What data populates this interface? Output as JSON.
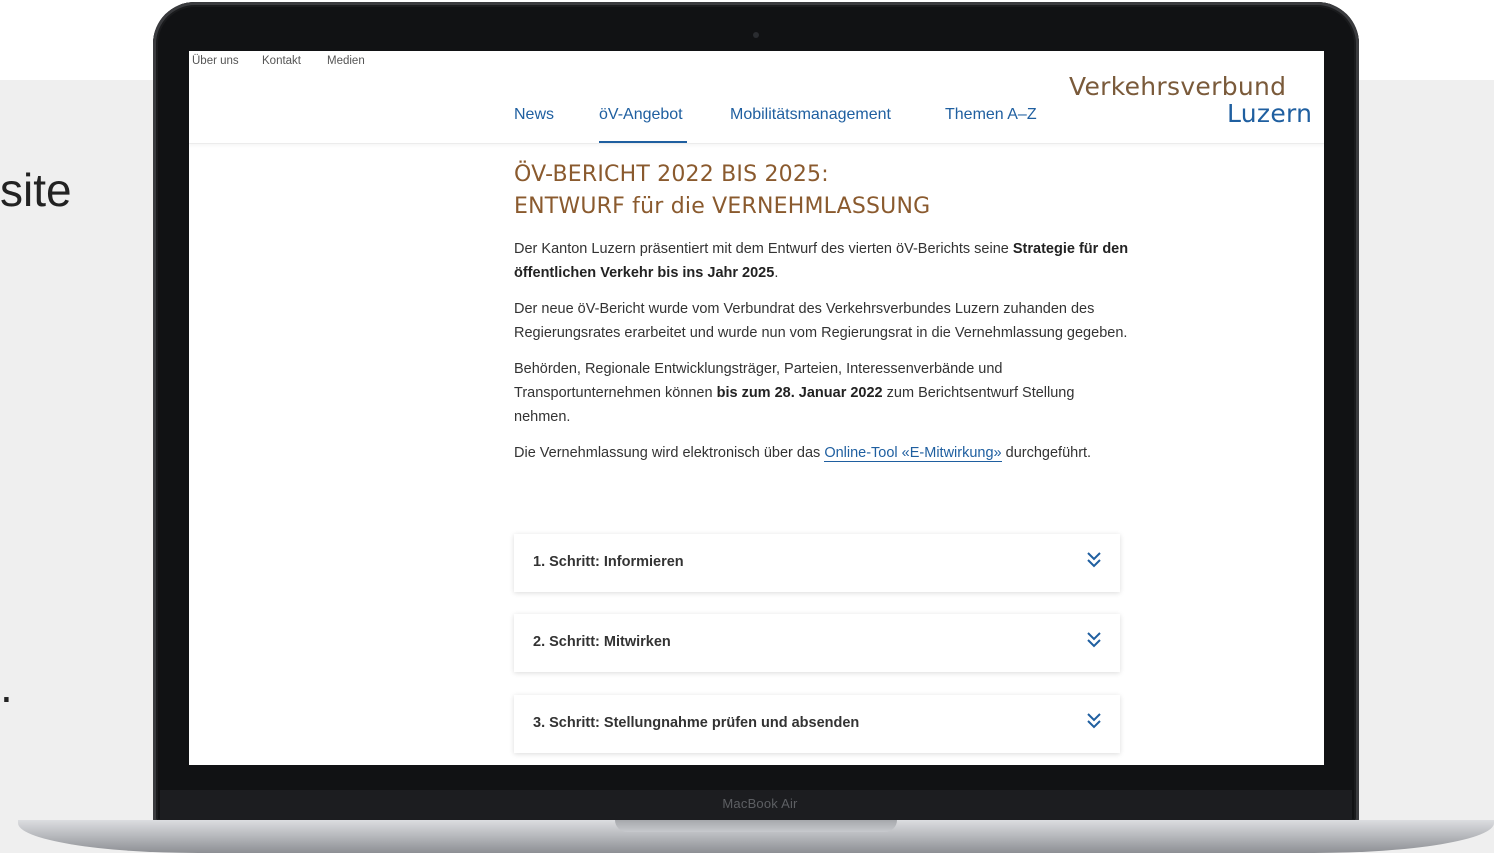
{
  "slide": {
    "partial_text_1": "site",
    "partial_text_2": "."
  },
  "laptop": {
    "model_label": "MacBook Air"
  },
  "site": {
    "utility_nav": [
      "Über uns",
      "Kontakt",
      "Medien"
    ],
    "main_nav": [
      {
        "label": "News",
        "active": false
      },
      {
        "label": "öV-Angebot",
        "active": true
      },
      {
        "label": "Mobilitätsmanagement",
        "active": false
      },
      {
        "label": "Themen A–Z",
        "active": false
      }
    ],
    "logo": {
      "line1": "Verkehrsverbund",
      "line2": "Luzern"
    },
    "heading": {
      "line1": "ÖV-BERICHT 2022 BIS 2025:",
      "line2": "ENTWURF für die VERNEHMLASSUNG"
    },
    "paragraphs": {
      "p1_a": "Der Kanton Luzern präsentiert mit dem Entwurf des vierten öV-Berichts seine ",
      "p1_b": "Strategie für den öffentlichen Verkehr bis ins Jahr 2025",
      "p1_c": ".",
      "p2": "Der neue öV-Bericht wurde vom Verbundrat des Verkehrsverbundes Luzern zuhanden des Regierungsrates erarbeitet und wurde nun vom Regierungsrat in die Vernehmlassung gegeben.",
      "p3_a": "Behörden, Regionale Entwicklungsträger, Parteien, Interessenverbände und Transportunternehmen können ",
      "p3_b": "bis zum 28. Januar 2022",
      "p3_c": " zum Berichtsentwurf Stellung nehmen.",
      "p4_a": "Die Vernehmlassung wird elektronisch über das ",
      "p4_link": "Online-Tool «E-Mitwirkung»",
      "p4_b": " durchgeführt."
    },
    "accordion": [
      {
        "label": "1. Schritt: Informieren",
        "icon": "double-chevron-down-icon"
      },
      {
        "label": "2. Schritt: Mitwirken",
        "icon": "double-chevron-down-icon"
      },
      {
        "label": "3. Schritt: Stellungnahme prüfen und absenden",
        "icon": "double-chevron-down-icon"
      }
    ],
    "colors": {
      "link_blue": "#1f5fa0",
      "heading_brown": "#8a5a2e",
      "logo_brown": "#7a5a3a"
    }
  }
}
